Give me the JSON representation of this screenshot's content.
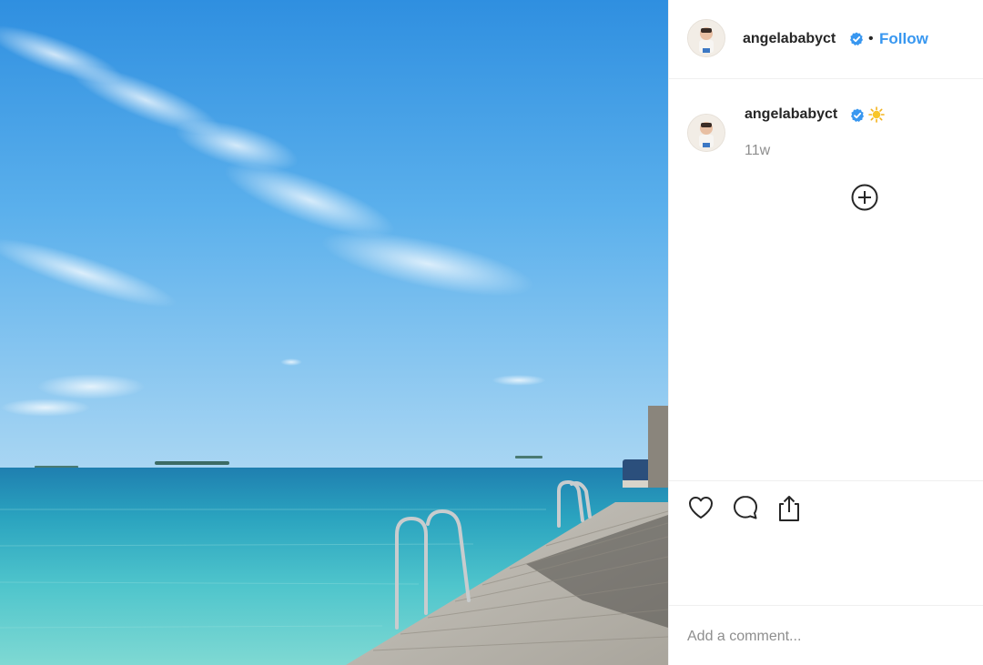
{
  "post": {
    "author": {
      "username": "angelababyct",
      "verified": true,
      "avatar_icon": "avatar-icon"
    },
    "follow_label": "Follow",
    "separator": "•",
    "caption": {
      "username": "angelababyct",
      "emoji": "sun-emoji-icon",
      "time_ago": "11w"
    },
    "actions": {
      "like_icon": "heart-icon",
      "comment_icon": "comment-icon",
      "share_icon": "share-icon"
    },
    "comment_placeholder": "Add a comment..."
  },
  "colors": {
    "accent": "#3897f0",
    "text": "#262626",
    "muted": "#8e8e8e",
    "border": "#efefef"
  }
}
